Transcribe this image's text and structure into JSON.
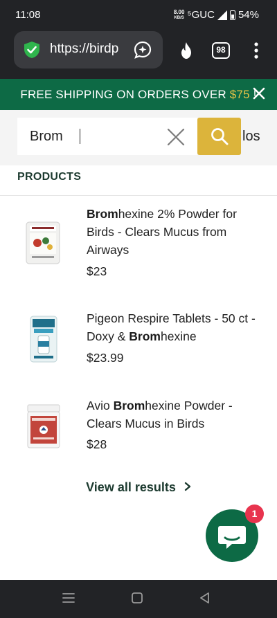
{
  "status_bar": {
    "time": "11:08",
    "net_speed_value": "8.00",
    "net_speed_unit": "KB/S",
    "network": "⁵GUC",
    "battery": "54%"
  },
  "browser": {
    "url": "https://birdp",
    "tab_count": "98"
  },
  "banner": {
    "text": "FREE SHIPPING ON ORDERS OVER ",
    "price": "$75",
    "suffix": " !"
  },
  "search": {
    "value": "Brom",
    "peek_text": "los"
  },
  "products_heading": "PRODUCTS",
  "products": [
    {
      "title_bold": "Brom",
      "title_rest": "hexine 2% Powder for Birds - Clears Mucus from Airways",
      "price": "$23"
    },
    {
      "title_pre": "Pigeon Respire Tablets - 50 ct - Doxy & ",
      "title_bold": "Brom",
      "title_rest": "hexine",
      "price": "$23.99"
    },
    {
      "title_pre": "Avio ",
      "title_bold": "Brom",
      "title_rest": "hexine Powder - Clears Mucus in Birds",
      "price": "$28"
    }
  ],
  "view_all": "View all results",
  "chat_badge": "1",
  "colors": {
    "brand_green": "#0d6a45",
    "accent_gold": "#dcb43b",
    "badge_red": "#e8344e"
  }
}
